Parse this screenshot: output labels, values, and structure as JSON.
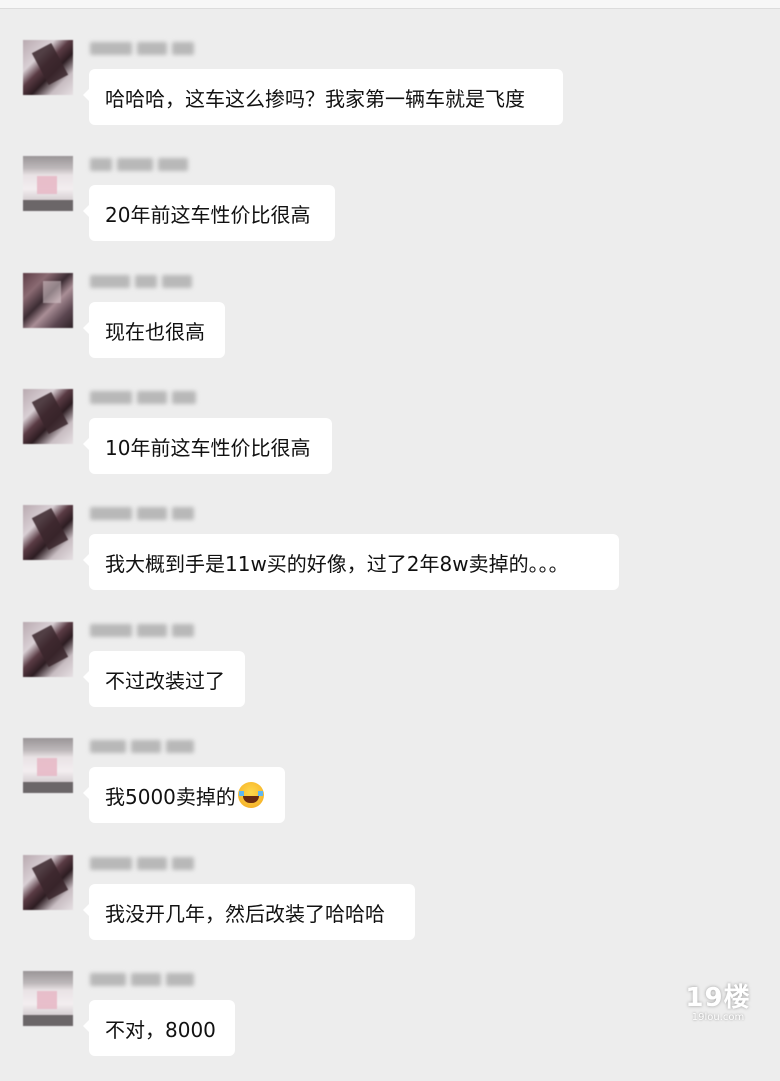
{
  "messages": [
    {
      "text": "哈哈哈，这车这么掺吗？我家第一辆车就是飞度"
    },
    {
      "text": "20年前这车性价比很高"
    },
    {
      "text": "现在也很高"
    },
    {
      "text": "10年前这车性价比很高"
    },
    {
      "text": "我大概到手是11w买的好像，过了2年8w卖掉的。。。"
    },
    {
      "text": "不过改装过了"
    },
    {
      "text": "我5000卖掉的",
      "emoji": "tears-of-joy-emoji"
    },
    {
      "text": "我没开几年，然后改装了哈哈哈"
    },
    {
      "text": "不对，8000"
    }
  ],
  "watermark": {
    "brand": "19楼",
    "url": "19lou.com"
  }
}
